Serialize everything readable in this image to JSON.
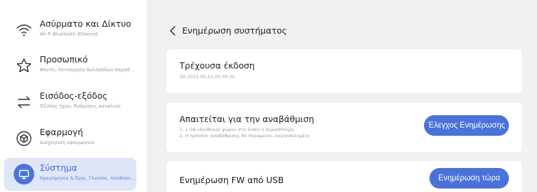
{
  "sidebar": {
    "items": [
      {
        "title": "Ασύρματο και Δίκτυο",
        "subtitle": "Wi-Fi Bluetooth Ethernet",
        "icon": "wifi-icon"
      },
      {
        "title": "Προσωπικό",
        "subtitle": "Φόντο, Λειτουργία πολλαπλών παραθύρων",
        "icon": "star-icon"
      },
      {
        "title": "Εισόδος-εξόδος",
        "subtitle": "Έξοδος ήχου, Ρυθμίσεις καναλιού",
        "icon": "swap-arrows-icon"
      },
      {
        "title": "Εφαρμογή",
        "subtitle": "Διαχείριση εφαρμογών",
        "icon": "cube-icon"
      },
      {
        "title": "Σύστημα",
        "subtitle": "Ημερομηνία & Ώρα, Γλώσσα, Αποθήκευση",
        "icon": "monitor-icon",
        "active": true
      }
    ]
  },
  "header": {
    "title": "Ενημέρωση συστήματος"
  },
  "cards": {
    "version": {
      "title": "Τρέχουσα έκδοση",
      "value": "OS 2023-05-21-00:39:35"
    },
    "requirements": {
      "title": "Απαιτείται για την αναβάθμιση",
      "line1": "1. 1 GB ελεύθερου χώρου στο δίσκο ή περισσότερο.",
      "line2": "2. Η πρόοδος αναβάθμισης θα παραμείνει ενεργοποιημένη",
      "button": "Έλεγχος Ενημέρωσης"
    },
    "usb": {
      "title": "Ενημέρωση FW από USB",
      "button": "Ενημέρωση τώρα"
    }
  },
  "colors": {
    "accent": "#4a72d9",
    "active_bg": "#dfe6f7",
    "background": "#f1f1f3"
  }
}
